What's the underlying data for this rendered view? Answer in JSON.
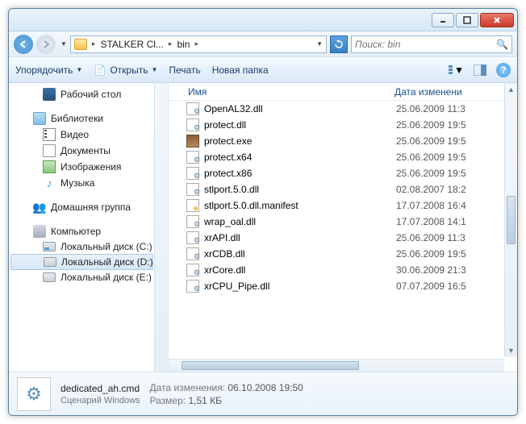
{
  "titlebar": {
    "min": "_",
    "max": "□",
    "close": "×"
  },
  "breadcrumbs": {
    "item1": "STALKER Cl...",
    "item2": "bin"
  },
  "search": {
    "placeholder": "Поиск: bin"
  },
  "toolbar": {
    "organize": "Упорядочить",
    "open": "Открыть",
    "print": "Печать",
    "newfolder": "Новая папка"
  },
  "tree": {
    "desktop": "Рабочий стол",
    "libraries": "Библиотеки",
    "video": "Видео",
    "documents": "Документы",
    "images": "Изображения",
    "music": "Музыка",
    "homegroup": "Домашняя группа",
    "computer": "Компьютер",
    "driveC": "Локальный диск (C:)",
    "driveD": "Локальный диск (D:)",
    "driveE": "Локальный диск (E:)"
  },
  "columns": {
    "name": "Имя",
    "date": "Дата изменени"
  },
  "files": [
    {
      "name": "OpenAL32.dll",
      "date": "25.06.2009 11:3",
      "type": "dll"
    },
    {
      "name": "protect.dll",
      "date": "25.06.2009 19:5",
      "type": "dll"
    },
    {
      "name": "protect.exe",
      "date": "25.06.2009 19:5",
      "type": "exe"
    },
    {
      "name": "protect.x64",
      "date": "25.06.2009 19:5",
      "type": "dll"
    },
    {
      "name": "protect.x86",
      "date": "25.06.2009 19:5",
      "type": "dll"
    },
    {
      "name": "stlport.5.0.dll",
      "date": "02.08.2007 18:2",
      "type": "dll"
    },
    {
      "name": "stlport.5.0.dll.manifest",
      "date": "17.07.2008 16:4",
      "type": "man"
    },
    {
      "name": "wrap_oal.dll",
      "date": "17.07.2008 14:1",
      "type": "dll"
    },
    {
      "name": "xrAPI.dll",
      "date": "25.06.2009 11:3",
      "type": "dll"
    },
    {
      "name": "xrCDB.dll",
      "date": "25.06.2009 19:5",
      "type": "dll"
    },
    {
      "name": "xrCore.dll",
      "date": "30.06.2009 21:3",
      "type": "dll"
    },
    {
      "name": "xrCPU_Pipe.dll",
      "date": "07.07.2009 16:5",
      "type": "dll"
    }
  ],
  "details": {
    "filename": "dedicated_ah.cmd",
    "filetype": "Сценарий Windows",
    "modlabel": "Дата изменения:",
    "moddate": "06.10.2008 19:50",
    "sizelabel": "Размер:",
    "size": "1,51 КБ"
  }
}
